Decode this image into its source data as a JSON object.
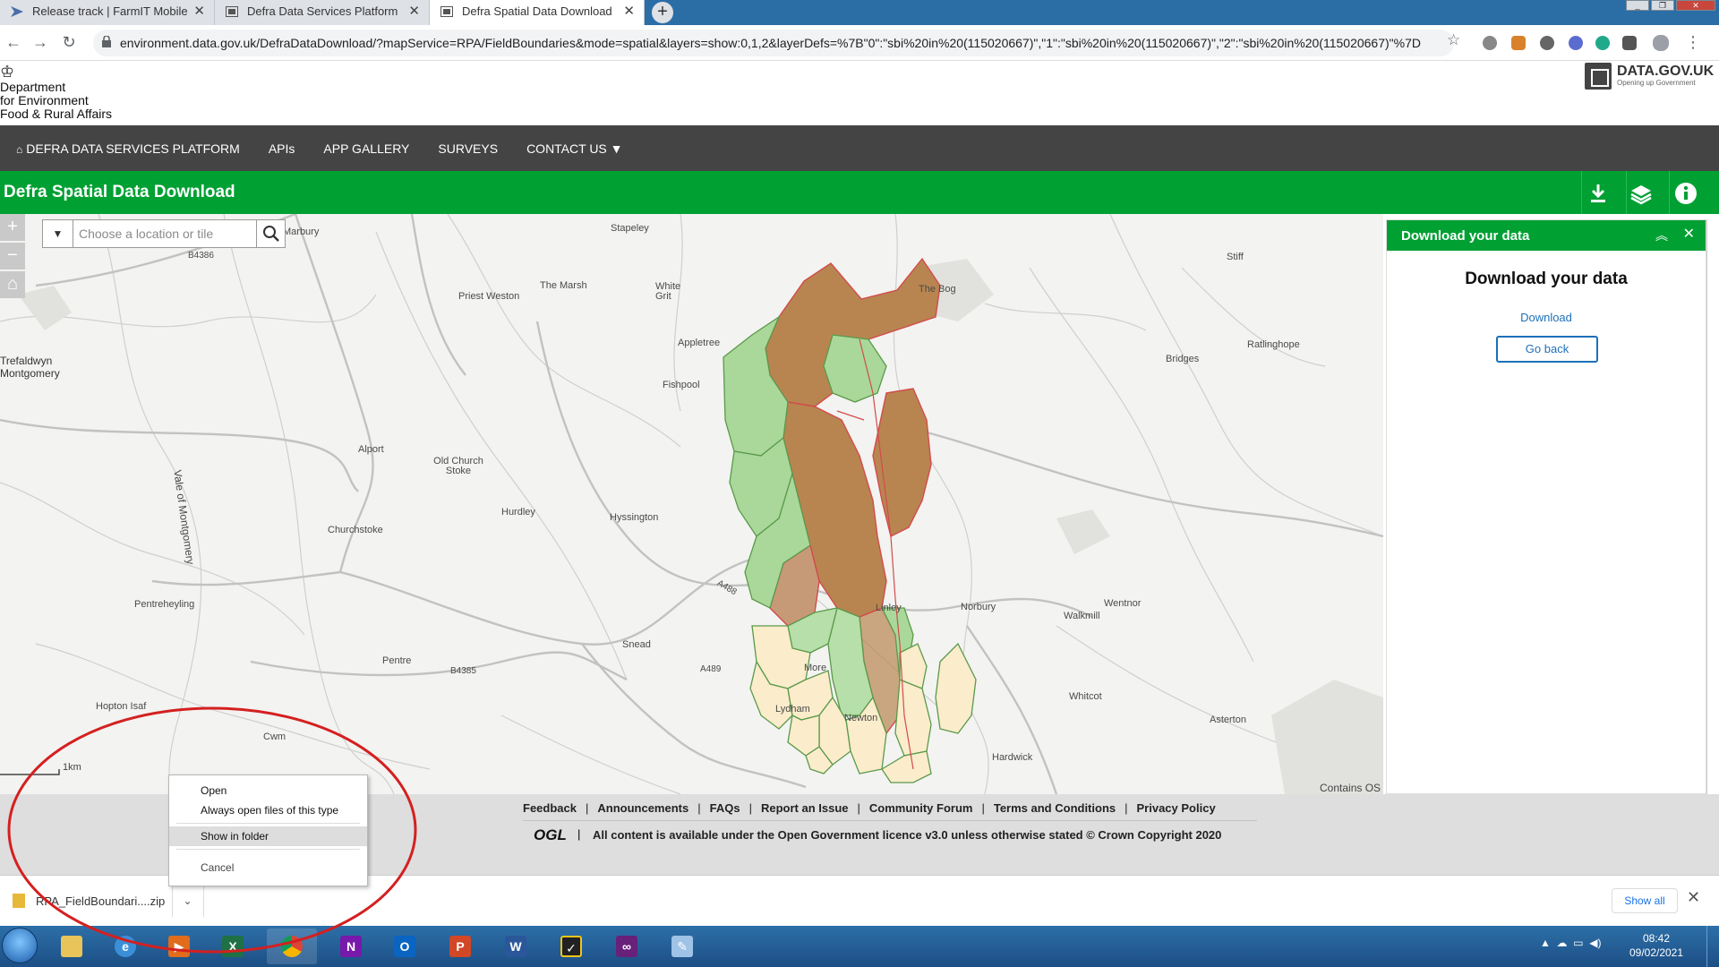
{
  "browser": {
    "tabs": [
      {
        "label": "Release track | FarmIT Mobile"
      },
      {
        "label": "Defra Data Services Platform"
      },
      {
        "label": "Defra Spatial Data Download"
      }
    ],
    "url": "environment.data.gov.uk/DefraDataDownload/?mapService=RPA/FieldBoundaries&mode=spatial&layers=show:0,1,2&layerDefs=%7B\"0\":\"sbi%20in%20(115020667)\",\"1\":\"sbi%20in%20(115020667)\",\"2\":\"sbi%20in%20(115020667)\"%7D",
    "new_tab": "+",
    "close_glyph": "✕"
  },
  "header": {
    "dept_lines": [
      "Department",
      "for Environment",
      "Food & Rural Affairs"
    ],
    "datagov_name": "DATA.GOV.UK",
    "datagov_tag": "Opening up Government"
  },
  "nav": {
    "items": [
      "DEFRA DATA SERVICES PLATFORM",
      "APIs",
      "APP GALLERY",
      "SURVEYS",
      "CONTACT US ▼"
    ]
  },
  "app": {
    "title": "Defra Spatial Data Download"
  },
  "map": {
    "search_placeholder": "Choose a location or tile",
    "scale_label": "1km",
    "attribution": "Contains OS",
    "places": [
      "Stapeley",
      "Priest Weston",
      "The Marsh",
      "White Grit",
      "The Bog",
      "Stiff",
      "Trefaldwyn Montgomery",
      "Appletree",
      "Fishpool",
      "Bridges",
      "Ratlinghope",
      "Alport",
      "Old Church Stoke",
      "Hurdley",
      "Hyssington",
      "Churchstoke",
      "Vale of Montgomery",
      "Linley",
      "Norbury",
      "Walkmill",
      "Wentnor",
      "Pentreheyling",
      "Pentre",
      "Snead",
      "Hopton Isaf",
      "Cwm",
      "Lydham",
      "Newton",
      "Whitcot",
      "Asterton",
      "Hardwick",
      "More",
      "Marbury"
    ],
    "roads": [
      "B4386",
      "B4385",
      "A489",
      "A488"
    ]
  },
  "panel": {
    "header_title": "Download your data",
    "heading": "Download your data",
    "download_link": "Download",
    "go_back": "Go back"
  },
  "footer": {
    "links": [
      "Feedback",
      "Announcements",
      "FAQs",
      "Report an Issue",
      "Community Forum",
      "Terms and Conditions",
      "Privacy Policy"
    ],
    "ogl": "OGL",
    "licence": "All content is available under the Open Government licence v3.0 unless otherwise stated © Crown Copyright 2020"
  },
  "context_menu": {
    "items": [
      "Open",
      "Always open files of this type",
      "Show in folder",
      "Cancel"
    ],
    "highlighted": "Show in folder"
  },
  "download_shelf": {
    "filename": "RPA_FieldBoundari....zip",
    "show_all": "Show all"
  },
  "taskbar": {
    "time": "08:42",
    "date": "09/02/2021",
    "apps": [
      "file-explorer",
      "internet-explorer",
      "media-player",
      "excel",
      "chrome",
      "onenote",
      "outlook",
      "powerpoint",
      "word",
      "todo",
      "visual-studio",
      "paint"
    ]
  },
  "colors": {
    "accent_green": "#00a033",
    "nav_dark": "#444444",
    "link_blue": "#1d70b8",
    "annotation_red": "#d42020"
  }
}
